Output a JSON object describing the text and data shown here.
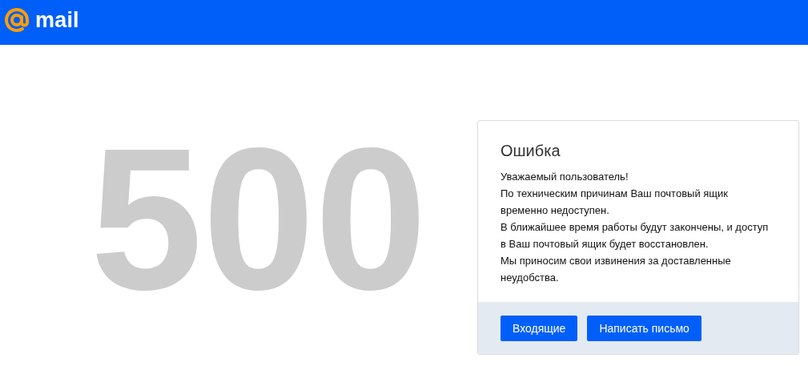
{
  "header": {
    "logo_text": "mail"
  },
  "error_code": "500",
  "card": {
    "title": "Ошибка",
    "message": [
      "Уважаемый пользователь!",
      "По техническим причинам Ваш почтовый ящик временно недоступен.",
      "В ближайшее время работы будут закончены, и доступ в Ваш почтовый ящик будет восстановлен.",
      "Мы приносим свои извинения за доставленные неудобства."
    ],
    "buttons": [
      "Входящие",
      "Написать письмо"
    ]
  }
}
